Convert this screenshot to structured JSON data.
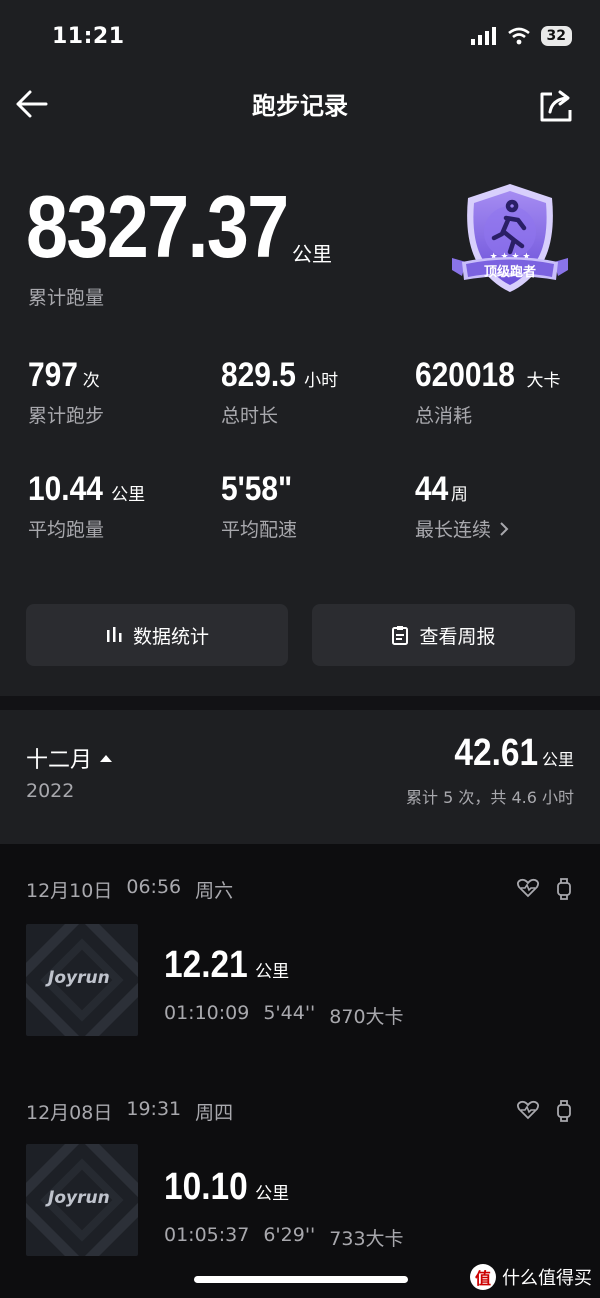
{
  "status_bar": {
    "time": "11:21",
    "battery": "32"
  },
  "header": {
    "title": "跑步记录"
  },
  "summary": {
    "total_distance": "8327.37",
    "total_distance_unit": "公里",
    "total_distance_label": "累计跑量",
    "badge_text": "顶级跑者"
  },
  "stats": [
    {
      "value": "797",
      "unit": "次",
      "label": "累计跑步"
    },
    {
      "value": "829.5",
      "unit": "小时",
      "label": "总时长"
    },
    {
      "value": "620018",
      "unit": "大卡",
      "label": "总消耗"
    },
    {
      "value": "10.44",
      "unit": "公里",
      "label": "平均跑量"
    },
    {
      "value": "5'58\"",
      "unit": "",
      "label": "平均配速"
    },
    {
      "value": "44",
      "unit": "周",
      "label": "最长连续"
    }
  ],
  "buttons": {
    "stats": "数据统计",
    "weekly": "查看周报"
  },
  "month": {
    "title": "十二月",
    "year": "2022",
    "distance": "42.61",
    "distance_unit": "公里",
    "summary": "累计 5 次，共 4.6 小时"
  },
  "records": [
    {
      "date": "12月10日",
      "time": "06:56",
      "weekday": "周六",
      "thumb_text": "Joyrun",
      "distance": "12.21",
      "unit": "公里",
      "duration": "01:10:09",
      "pace": "5'44''",
      "calories": "870大卡"
    },
    {
      "date": "12月08日",
      "time": "19:31",
      "weekday": "周四",
      "thumb_text": "Joyrun",
      "distance": "10.10",
      "unit": "公里",
      "duration": "01:05:37",
      "pace": "6'29''",
      "calories": "733大卡"
    }
  ],
  "watermark": {
    "logo": "值",
    "text": "什么值得买"
  }
}
